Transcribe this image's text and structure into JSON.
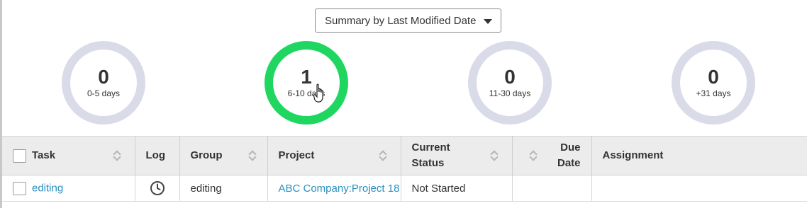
{
  "summary_select": {
    "selected": "Summary by Last Modified Date"
  },
  "rings": [
    {
      "count": "0",
      "range": "0-5 days",
      "active": false
    },
    {
      "count": "1",
      "range": "6-10 days",
      "active": true
    },
    {
      "count": "0",
      "range": "11-30 days",
      "active": false
    },
    {
      "count": "0",
      "range": "+31 days",
      "active": false
    }
  ],
  "table": {
    "headers": {
      "task": "Task",
      "log": "Log",
      "group": "Group",
      "project": "Project",
      "status_line1": "Current",
      "status_line2": "Status",
      "due_line1": "Due",
      "due_line2": "Date",
      "assignment": "Assignment"
    },
    "rows": [
      {
        "task": "editing",
        "group": "editing",
        "project": "ABC Company:Project 18",
        "status": "Not Started",
        "due": "",
        "assignment": ""
      }
    ]
  },
  "colors": {
    "ring_active": "#1fd760",
    "ring_idle": "#d9dbe8",
    "link": "#2a8fbd"
  }
}
